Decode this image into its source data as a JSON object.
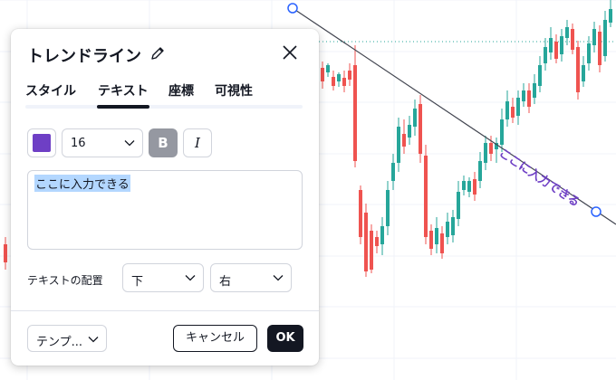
{
  "dialog": {
    "title": "トレンドライン",
    "tabs": [
      {
        "label": "スタイル",
        "active": false
      },
      {
        "label": "テキスト",
        "active": true
      },
      {
        "label": "座標",
        "active": false
      },
      {
        "label": "可視性",
        "active": false
      }
    ],
    "text_color": "#6e3fc5",
    "font_size": "16",
    "bold_label": "B",
    "italic_label": "I",
    "text_value": "ここに入力できる",
    "align_label": "テキストの配置",
    "vertical_align": "下",
    "horizontal_align": "右",
    "template_label": "テンプ...",
    "cancel_label": "キャンセル",
    "ok_label": "OK"
  },
  "chart": {
    "line_label": "ここに入力できる",
    "label_color": "#6e3fc5",
    "up_color": "#26a69a",
    "down_color": "#ef5350",
    "line_color": "#434651",
    "handle_color": "#2962ff"
  }
}
